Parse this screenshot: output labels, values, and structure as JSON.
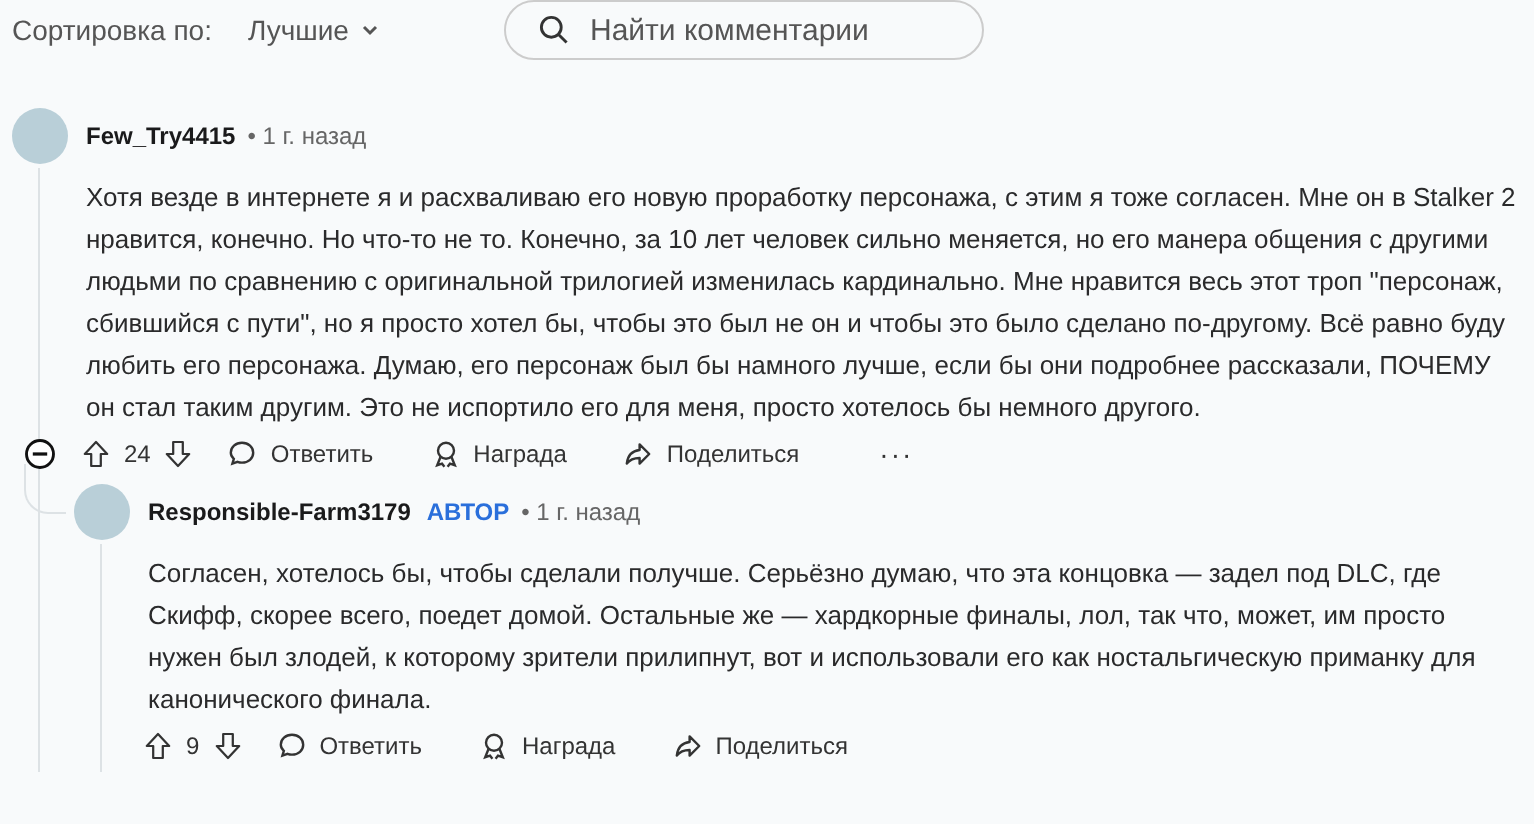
{
  "toolbar": {
    "sort_label": "Сортировка по:",
    "sort_value": "Лучшие",
    "search": {
      "placeholder": "Найти комментарии"
    }
  },
  "comments": [
    {
      "author": "Few_Try4415",
      "is_op": false,
      "time": "• 1 г. назад",
      "text": "Хотя везде в интернете я и расхваливаю его новую проработку персонажа, с этим я тоже согласен. Мне он в Stalker 2 нравится, конечно. Но что-то не то. Конечно, за 10 лет человек сильно меняется, но его манера общения с другими людьми по сравнению с оригинальной трилогией изменилась кардинально. Мне нравится весь этот троп \"персонаж, сбившийся с пути\", но я просто хотел бы, чтобы это был не он и чтобы это было сделано по-другому. Всё равно буду любить его персонажа. Думаю, его персонаж был бы намного лучше, если бы они подробнее рассказали, ПОЧЕМУ он стал таким другим. Это не испортило его для меня, просто хотелось бы немного другого.",
      "score": "24",
      "actions": [
        "Ответить",
        "Награда",
        "Поделиться"
      ],
      "more": "···",
      "collapsible": true,
      "replies": [
        {
          "author": "Responsible-Farm3179",
          "is_op": true,
          "op_badge": "АВТОР",
          "time": "• 1 г. назад",
          "text": "Согласен, хотелось бы, чтобы сделали получше. Серьёзно думаю, что эта концовка — задел под DLC, где Скифф, скорее всего, поедет домой. Остальные же — хардкорные финалы, лол, так что, может, им просто нужен был злодей, к которому зрители прилипнут, вот и использовали его как ностальгическую приманку для канонического финала.",
          "score": "9",
          "actions": [
            "Ответить",
            "Награда",
            "Поделиться"
          ],
          "collapsible": false
        }
      ]
    }
  ]
}
